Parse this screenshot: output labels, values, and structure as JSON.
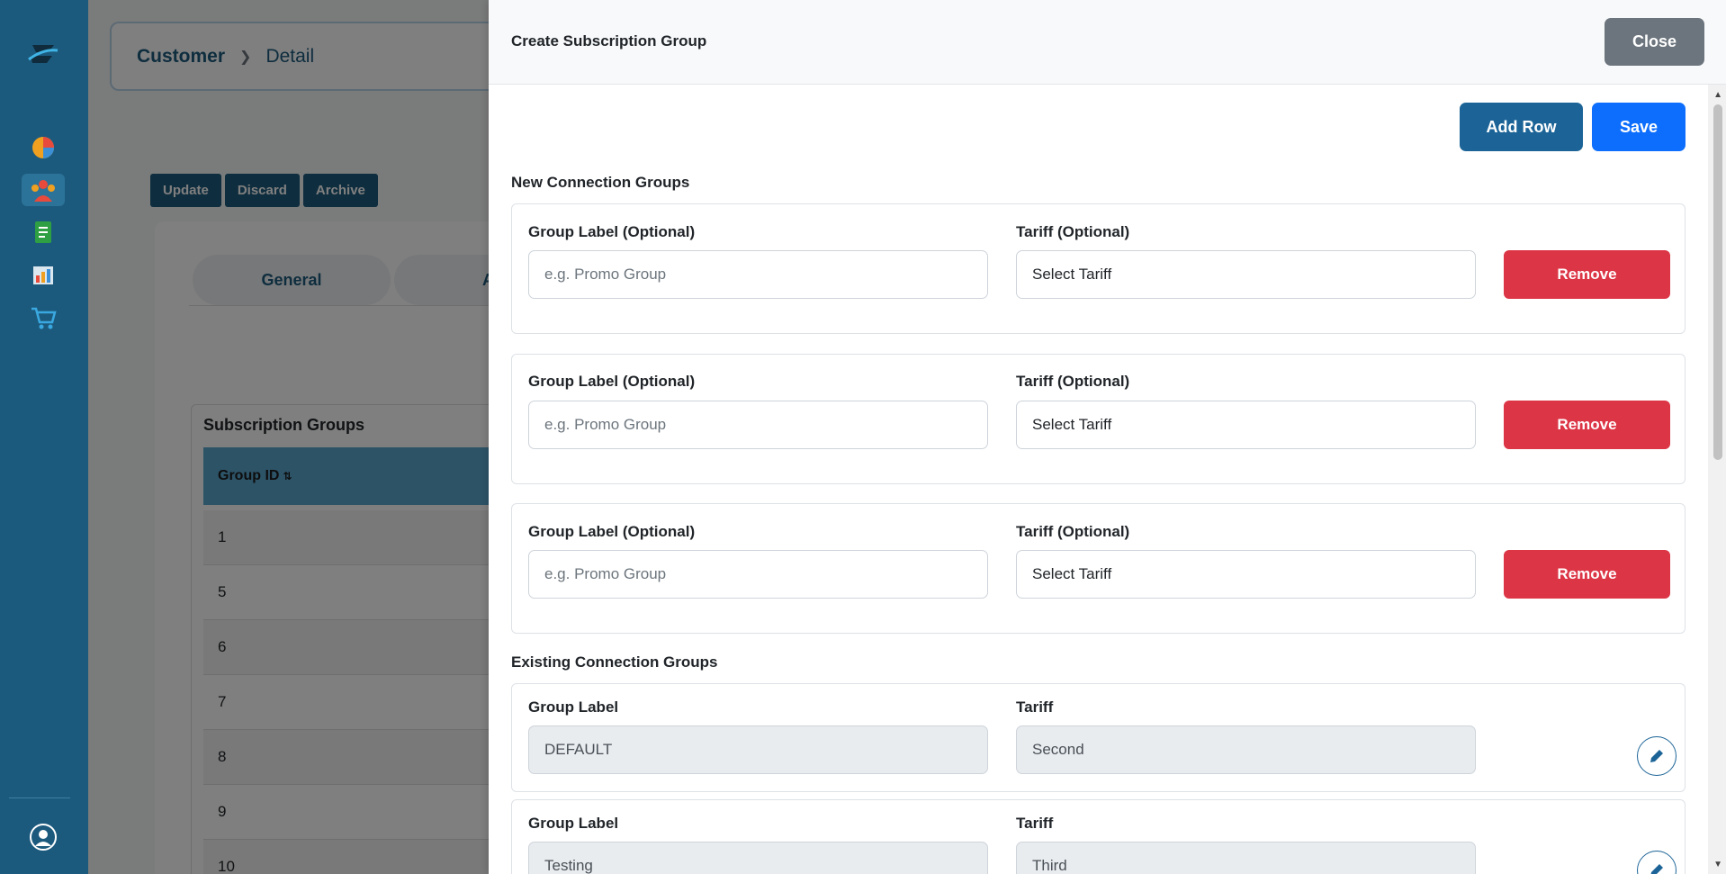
{
  "sidebar": {
    "icons": [
      "logo-icon",
      "analytics-icon",
      "customers-icon",
      "document-icon",
      "reports-icon",
      "cart-icon",
      "user-icon"
    ]
  },
  "background": {
    "breadcrumb": {
      "root": "Customer",
      "leaf": "Detail"
    },
    "actions": [
      "Update",
      "Discard",
      "Archive"
    ],
    "tabs": [
      "General",
      "Ad"
    ],
    "table_title": "Subscription Groups",
    "table_header": "Group ID",
    "table_rows": [
      "1",
      "5",
      "6",
      "7",
      "8",
      "9",
      "10"
    ]
  },
  "panel": {
    "title": "Create Subscription Group",
    "close_label": "Close",
    "add_row_label": "Add Row",
    "save_label": "Save",
    "new_section_title": "New Connection Groups",
    "existing_section_title": "Existing Connection Groups",
    "new_rows": [
      {
        "label_title": "Group Label (Optional)",
        "label_placeholder": "e.g. Promo Group",
        "tariff_title": "Tariff (Optional)",
        "tariff_value": "Select Tariff",
        "remove_label": "Remove"
      },
      {
        "label_title": "Group Label (Optional)",
        "label_placeholder": "e.g. Promo Group",
        "tariff_title": "Tariff (Optional)",
        "tariff_value": "Select Tariff",
        "remove_label": "Remove"
      },
      {
        "label_title": "Group Label (Optional)",
        "label_placeholder": "e.g. Promo Group",
        "tariff_title": "Tariff (Optional)",
        "tariff_value": "Select Tariff",
        "remove_label": "Remove"
      }
    ],
    "existing_rows": [
      {
        "label_title": "Group Label",
        "label_value": "DEFAULT",
        "tariff_title": "Tariff",
        "tariff_value": "Second"
      },
      {
        "label_title": "Group Label",
        "label_value": "Testing",
        "tariff_title": "Tariff",
        "tariff_value": "Third"
      }
    ]
  },
  "colors": {
    "sidebar": "#1c5a7d",
    "primary": "#0d6efd",
    "add_row": "#1c6497",
    "danger": "#dc3545",
    "secondary": "#6c757d"
  }
}
